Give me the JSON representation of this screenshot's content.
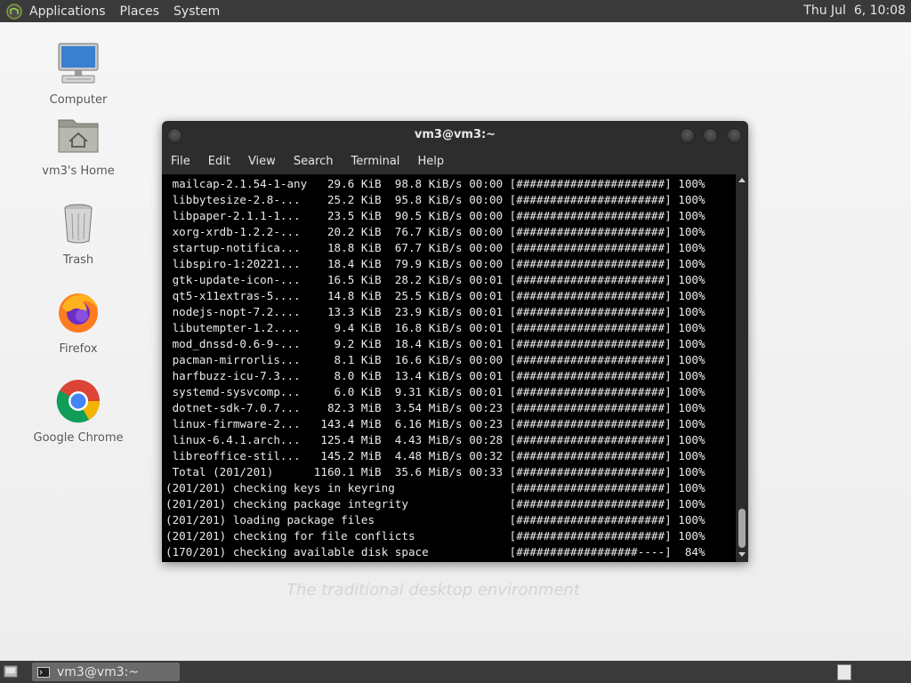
{
  "top_panel": {
    "menus": [
      "Applications",
      "Places",
      "System"
    ],
    "clock": "Thu Jul  6, 10:08"
  },
  "desktop": {
    "icons": [
      {
        "label": "Computer",
        "icon": "computer-icon"
      },
      {
        "label": "vm3's Home",
        "icon": "home-folder-icon"
      },
      {
        "label": "Trash",
        "icon": "trash-icon"
      },
      {
        "label": "Firefox",
        "icon": "firefox-icon"
      },
      {
        "label": "Google Chrome",
        "icon": "chrome-icon"
      }
    ],
    "watermark": "The traditional desktop environment"
  },
  "terminal": {
    "title": "vm3@vm3:~",
    "menu": [
      "File",
      "Edit",
      "View",
      "Search",
      "Terminal",
      "Help"
    ],
    "lines": [
      " mailcap-2.1.54-1-any   29.6 KiB  98.8 KiB/s 00:00 [######################] 100%",
      " libbytesize-2.8-...    25.2 KiB  95.8 KiB/s 00:00 [######################] 100%",
      " libpaper-2.1.1-1...    23.5 KiB  90.5 KiB/s 00:00 [######################] 100%",
      " xorg-xrdb-1.2.2-...    20.2 KiB  76.7 KiB/s 00:00 [######################] 100%",
      " startup-notifica...    18.8 KiB  67.7 KiB/s 00:00 [######################] 100%",
      " libspiro-1:20221...    18.4 KiB  79.9 KiB/s 00:00 [######################] 100%",
      " gtk-update-icon-...    16.5 KiB  28.2 KiB/s 00:01 [######################] 100%",
      " qt5-x11extras-5....    14.8 KiB  25.5 KiB/s 00:01 [######################] 100%",
      " nodejs-nopt-7.2....    13.3 KiB  23.9 KiB/s 00:01 [######################] 100%",
      " libutempter-1.2....     9.4 KiB  16.8 KiB/s 00:01 [######################] 100%",
      " mod_dnssd-0.6-9-...     9.2 KiB  18.4 KiB/s 00:01 [######################] 100%",
      " pacman-mirrorlis...     8.1 KiB  16.6 KiB/s 00:00 [######################] 100%",
      " harfbuzz-icu-7.3...     8.0 KiB  13.4 KiB/s 00:01 [######################] 100%",
      " systemd-sysvcomp...     6.0 KiB  9.31 KiB/s 00:01 [######################] 100%",
      " dotnet-sdk-7.0.7...    82.3 MiB  3.54 MiB/s 00:23 [######################] 100%",
      " linux-firmware-2...   143.4 MiB  6.16 MiB/s 00:23 [######################] 100%",
      " linux-6.4.1.arch...   125.4 MiB  4.43 MiB/s 00:28 [######################] 100%",
      " libreoffice-stil...   145.2 MiB  4.48 MiB/s 00:32 [######################] 100%",
      " Total (201/201)      1160.1 MiB  35.6 MiB/s 00:33 [######################] 100%",
      "(201/201) checking keys in keyring                 [######################] 100%",
      "(201/201) checking package integrity               [######################] 100%",
      "(201/201) loading package files                    [######################] 100%",
      "(201/201) checking for file conflicts              [######################] 100%",
      "(170/201) checking available disk space            [##################----]  84%"
    ]
  },
  "bottom_panel": {
    "task_label": "vm3@vm3:~"
  }
}
